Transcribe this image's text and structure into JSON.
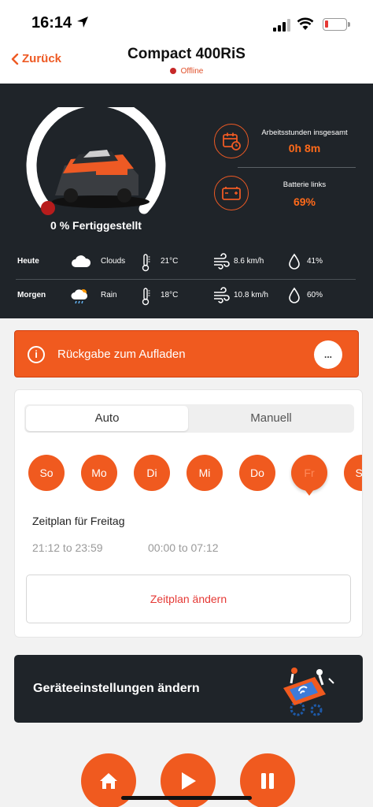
{
  "status_bar": {
    "time": "16:14"
  },
  "nav": {
    "back_label": "Zurück",
    "title": "Compact 400RiS",
    "status": "Offline"
  },
  "mower": {
    "progress_percent": 0,
    "progress_label": "0 % Fertiggestellt",
    "stats": [
      {
        "icon": "calendar-clock-icon",
        "label": "Arbeitsstunden insgesamt",
        "value": "0h 8m"
      },
      {
        "icon": "battery-icon",
        "label": "Batterie links",
        "value": "69%"
      }
    ]
  },
  "weather": [
    {
      "day": "Heute",
      "icon": "cloud-icon",
      "condition": "Clouds",
      "temp": "21°C",
      "wind": "8.6 km/h",
      "humidity": "41%"
    },
    {
      "day": "Morgen",
      "icon": "rain-cloud-icon",
      "condition": "Rain",
      "temp": "18°C",
      "wind": "10.8 km/h",
      "humidity": "60%"
    }
  ],
  "alert": {
    "text": "Rückgabe zum Aufladen",
    "more_label": "..."
  },
  "schedule": {
    "modes": [
      "Auto",
      "Manuell"
    ],
    "selected_mode": "Auto",
    "days": [
      "So",
      "Mo",
      "Di",
      "Mi",
      "Do",
      "Fr",
      "Sa"
    ],
    "selected_day": "Fr",
    "title": "Zeitplan für Freitag",
    "time_ranges": [
      "21:12 to 23:59",
      "00:00 to 07:12"
    ],
    "change_label": "Zeitplan ändern"
  },
  "settings": {
    "label": "Geräteeinstellungen ändern"
  },
  "controls": [
    {
      "name": "home",
      "icon": "home-icon"
    },
    {
      "name": "play",
      "icon": "play-icon"
    },
    {
      "name": "pause",
      "icon": "pause-icon"
    }
  ],
  "colors": {
    "accent": "#f05a1f",
    "dark_panel": "#1f2429",
    "value_orange": "#ff6a1a",
    "offline_red": "#c62828"
  }
}
